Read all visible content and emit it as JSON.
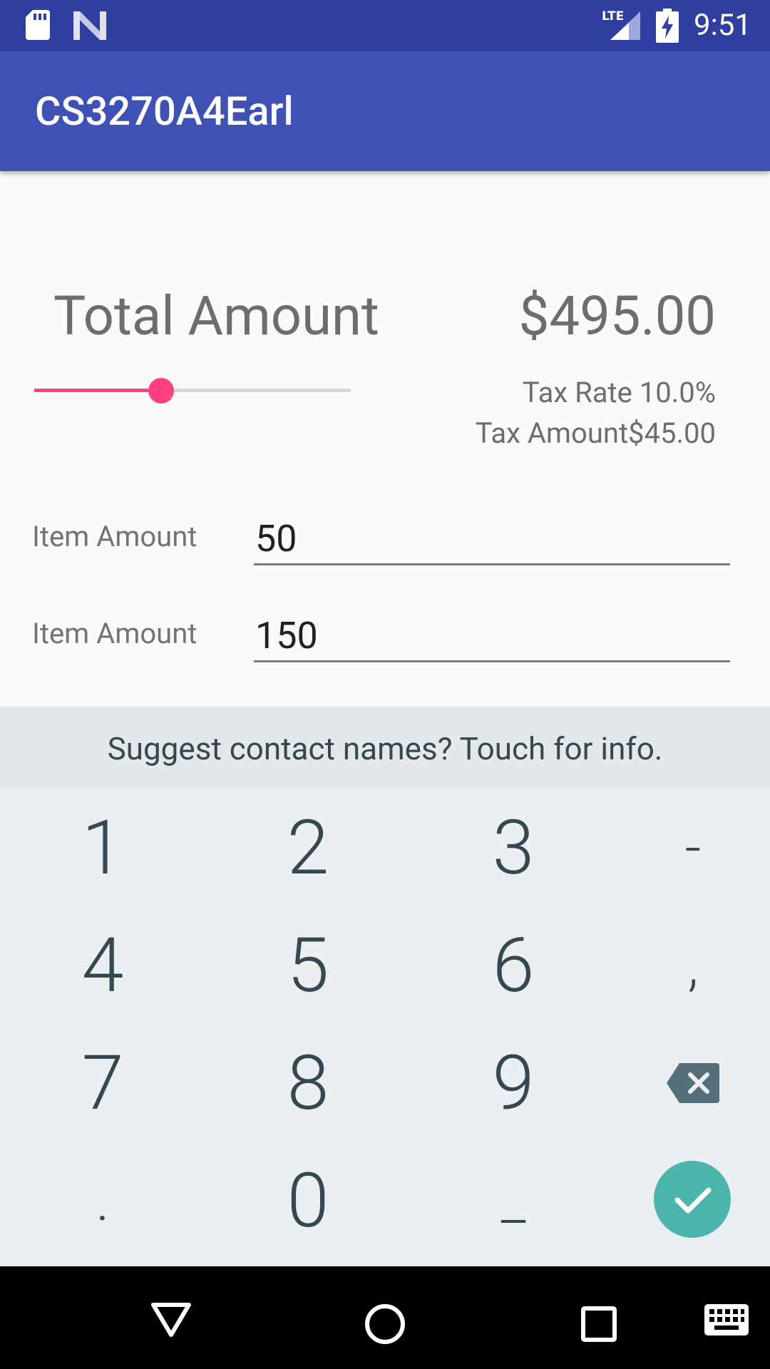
{
  "status_bar": {
    "time": "9:51",
    "icons": [
      "sd-card-icon",
      "n-logo-icon",
      "lte-signal-icon",
      "battery-charging-icon"
    ]
  },
  "app_bar": {
    "title": "CS3270A4Earl"
  },
  "summary": {
    "total_label": "Total Amount",
    "total_value": "$495.00",
    "tax_rate": "Tax Rate 10.0%",
    "tax_amount": "Tax Amount$45.00",
    "slider_fraction": 0.4
  },
  "items": [
    {
      "label": "Item Amount",
      "value": "50"
    },
    {
      "label": "Item Amount",
      "value": "150"
    }
  ],
  "suggestion": "Suggest contact names? Touch for info.",
  "keypad": {
    "keys": [
      "1",
      "2",
      "3",
      "-",
      "4",
      "5",
      "6",
      ",",
      "7",
      "8",
      "9",
      "backspace",
      ".",
      "0",
      "_",
      "enter"
    ],
    "backspace_icon": "backspace-icon",
    "enter_icon": "check-icon"
  },
  "nav_bar": {
    "icons": [
      "back-icon",
      "home-icon",
      "recents-icon",
      "keyboard-icon"
    ]
  },
  "colors": {
    "primary": "#3f51b5",
    "primary_dark": "#303f9f",
    "accent": "#ff4081",
    "enter_key": "#4db6ac"
  }
}
